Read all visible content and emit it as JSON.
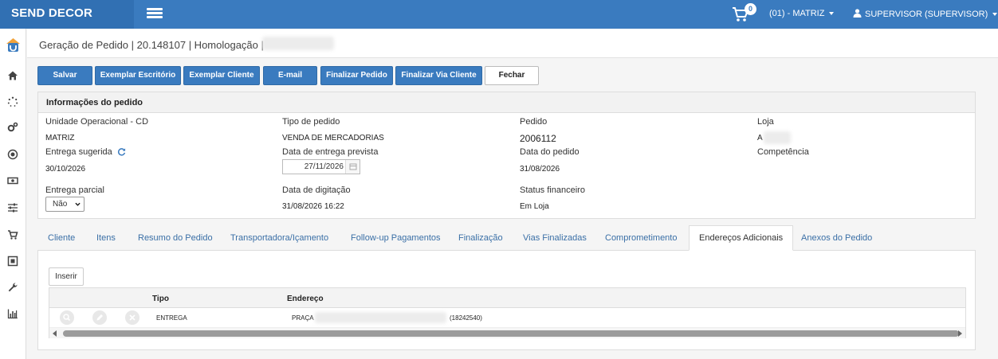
{
  "app": {
    "brand": "SEND DECOR"
  },
  "header": {
    "cart_count": "0",
    "store_selector": "(01) - MATRIZ",
    "user_menu": "SUPERVISOR (SUPERVISOR)"
  },
  "breadcrumb": {
    "text": "Geração de Pedido | 20.148107 | Homologação |"
  },
  "toolbar": {
    "save": "Salvar",
    "office_copy": "Exemplar Escritório",
    "client_copy": "Exemplar Cliente",
    "email": "E-mail",
    "finalize": "Finalizar Pedido",
    "finalize_client": "Finalizar Via Cliente",
    "close": "Fechar"
  },
  "info": {
    "title": "Informações do pedido",
    "unit_label": "Unidade Operacional - CD",
    "unit_value": "MATRIZ",
    "order_type_label": "Tipo de pedido",
    "order_type_value": "VENDA DE MERCADORIAS",
    "order_label": "Pedido",
    "order_value": "2006112",
    "store_label": "Loja",
    "store_value": "A",
    "suggested_delivery_label": "Entrega sugerida",
    "suggested_delivery_value": "30/10/2026",
    "expected_delivery_label": "Data de entrega prevista",
    "expected_delivery_value": "27/11/2026",
    "order_date_label": "Data do pedido",
    "order_date_value": "31/08/2026",
    "competence_label": "Competência",
    "partial_delivery_label": "Entrega parcial",
    "partial_delivery_value": "Não",
    "typing_date_label": "Data de digitação",
    "typing_date_value": "31/08/2026 16:22",
    "financial_status_label": "Status financeiro",
    "financial_status_value": "Em Loja"
  },
  "tabs": [
    {
      "label": "Cliente"
    },
    {
      "label": "Itens"
    },
    {
      "label": "Resumo do Pedido"
    },
    {
      "label": "Transportadora/Içamento"
    },
    {
      "label": "Follow-up Pagamentos"
    },
    {
      "label": "Finalização"
    },
    {
      "label": "Vias Finalizadas"
    },
    {
      "label": "Comprometimento"
    },
    {
      "label": "Endereços Adicionais"
    },
    {
      "label": "Anexos do Pedido"
    }
  ],
  "addresses": {
    "insert_label": "Inserir",
    "columns": {
      "type": "Tipo",
      "address": "Endereço"
    },
    "rows": [
      {
        "type": "ENTREGA",
        "address_prefix": "PRAÇA",
        "address_suffix": "(18242540)"
      }
    ]
  },
  "colors": {
    "primary": "#3a7bbf",
    "brand_bg": "#3170b3",
    "tab_link": "#3a6fa6"
  }
}
